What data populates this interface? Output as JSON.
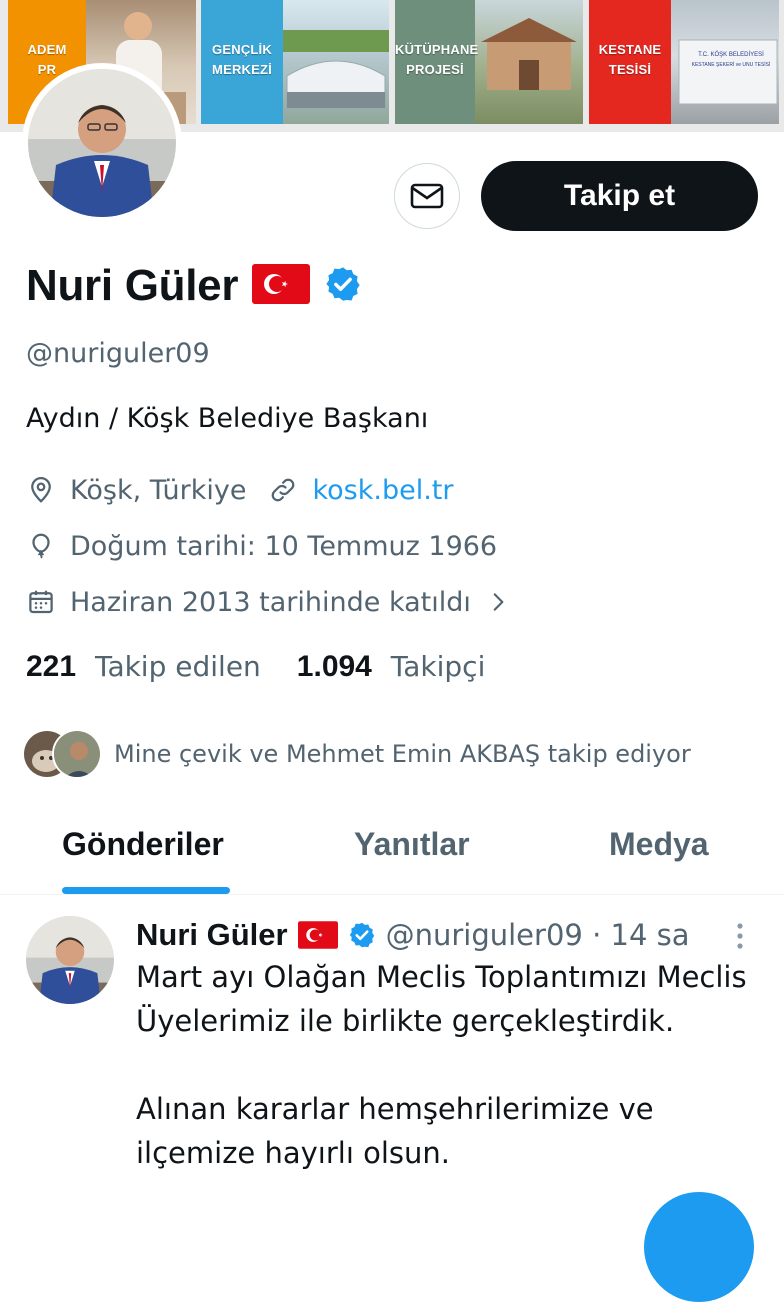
{
  "banner": {
    "tiles": [
      {
        "label": "ADEM PR...",
        "label_lines": [
          "ADEM",
          "PR"
        ],
        "bg": "#f39200",
        "photo": "#c9b7a0"
      },
      {
        "label": "GENÇLİK MERKEZİ",
        "label_lines": [
          "GENÇLİK",
          "MERKEZİ"
        ],
        "bg": "#3aa6d8",
        "photo": "#9bb5c2"
      },
      {
        "label": "KÜTÜPHANE PROJESİ",
        "label_lines": [
          "KÜTÜPHANE",
          "PROJESİ"
        ],
        "bg": "#6f8f7d",
        "photo": "#a89078"
      },
      {
        "label": "KESTANE TESİSİ",
        "label_lines": [
          "KESTANE",
          "TESİSİ"
        ],
        "bg": "#e4271f",
        "photo": "#c7d0d6"
      }
    ],
    "sign_text": [
      "T.C. KÖŞK BELEDİYESİ",
      "KESTANE ŞEKERİ ve UNU TESİSİ"
    ]
  },
  "profile": {
    "name": "Nuri Güler",
    "flag": "turkey-flag",
    "verified": true,
    "handle": "@nuriguler09",
    "bio": "Aydın / Köşk Belediye Başkanı",
    "location": "Köşk, Türkiye",
    "website": "kosk.bel.tr",
    "birthday": "Doğum tarihi: 10 Temmuz 1966",
    "joined": "Haziran 2013 tarihinde katıldı",
    "following_count": "221",
    "following_label": "Takip edilen",
    "followers_count": "1.094",
    "followers_label": "Takipçi",
    "followed_by": "Mine çevik ve Mehmet Emin AKBAŞ takip ediyor"
  },
  "actions": {
    "follow_label": "Takip et",
    "message_icon": "envelope-icon"
  },
  "tabs": [
    {
      "label": "Gönderiler",
      "active": true
    },
    {
      "label": "Yanıtlar",
      "active": false
    },
    {
      "label": "Medya",
      "active": false
    }
  ],
  "tweet": {
    "author": "Nuri Güler",
    "handle_time": "@nuriguler09 · 14 sa",
    "paragraphs": [
      "Mart ayı Olağan Meclis Toplantımızı Meclis Üyelerimiz ile birlikte gerçekleştirdik.",
      "Alınan kararlar hemşehrilerimize ve ilçemize hayırlı olsun."
    ]
  },
  "colors": {
    "accent": "#1d9bf0",
    "text": "#0f1419",
    "muted": "#536471",
    "button_dark": "#0f1419"
  }
}
